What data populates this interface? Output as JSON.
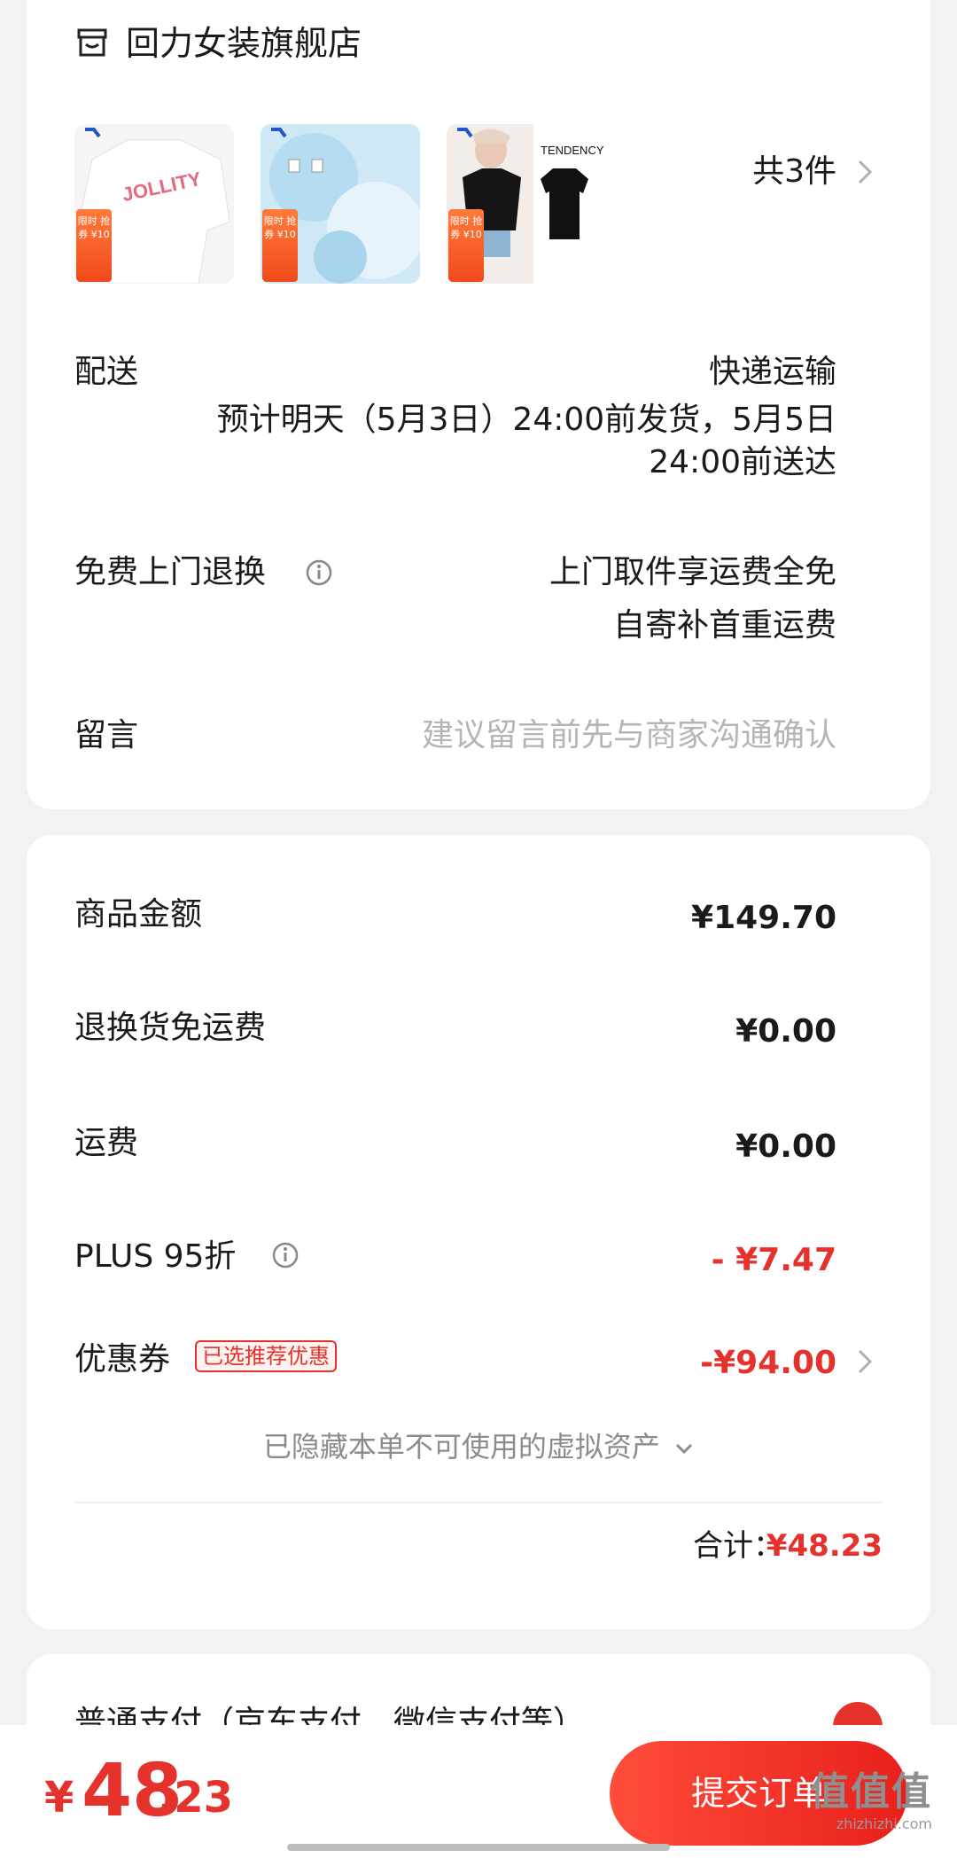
{
  "store": {
    "icon": "store-icon",
    "name": "回力女装旗舰店",
    "products": [
      {
        "title": "JOLLITY",
        "badge": "限时 抢券 ¥10"
      },
      {
        "title": "",
        "badge": "限时 抢券 ¥10"
      },
      {
        "title": "TENDENCY",
        "badge": "限时 抢券 ¥10"
      }
    ],
    "count_label": "共3件"
  },
  "delivery": {
    "label": "配送",
    "method": "快递运输",
    "eta_line1": "预计明天（5月3日）24:00前发货，5月5日",
    "eta_line2": "24:00前送达"
  },
  "return": {
    "label": "免费上门退换",
    "line1": "上门取件享运费全免",
    "line2": "自寄补首重运费"
  },
  "message": {
    "label": "留言",
    "placeholder": "建议留言前先与商家沟通确认"
  },
  "price": {
    "rows": [
      {
        "label": "商品金额",
        "value": "¥149.70"
      },
      {
        "label": "退换货免运费",
        "value": "¥0.00"
      },
      {
        "label": "运费",
        "value": "¥0.00"
      },
      {
        "label": "PLUS 95折",
        "value": "- ¥7.47"
      },
      {
        "label": "优惠券",
        "value": "-¥94.00"
      }
    ],
    "coupon_badge": "已选推荐优惠",
    "hidden_note": "已隐藏本单不可使用的虚拟资产",
    "total_label": "合计：",
    "total_value": "¥48.23"
  },
  "payment": {
    "text": "普通支付（京东支付、微信支付等）"
  },
  "bottom": {
    "currency": "¥",
    "amount_int": "48",
    "amount_dec": ".23",
    "submit_label": "提交订单"
  },
  "watermark": {
    "main": "值值值",
    "sub": "zhizhizhi.com"
  },
  "colors": {
    "accent": "#e5322d",
    "background": "#f2f2f2",
    "card": "#ffffff"
  }
}
